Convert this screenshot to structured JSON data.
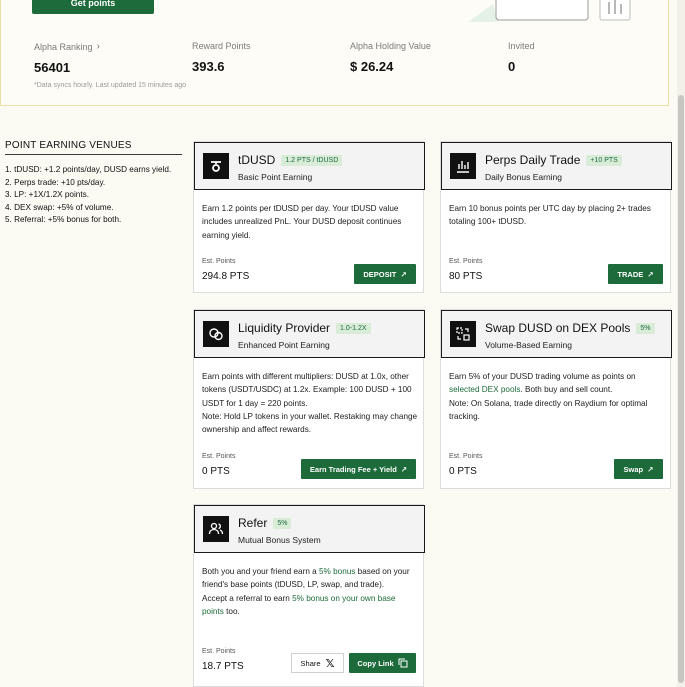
{
  "header": {
    "get_points_label": "Get points",
    "stats": [
      {
        "label": "Alpha Ranking",
        "value": "56401"
      },
      {
        "label": "Reward Points",
        "value": "393.6"
      },
      {
        "label": "Alpha Holding Value",
        "value": "$ 26.24"
      },
      {
        "label": "Invited",
        "value": "0"
      }
    ],
    "sync_note": "*Data syncs hourly. Last updated 15 minutes ago"
  },
  "venues": {
    "title": "POINT EARNING VENUES",
    "items": [
      "1. tDUSD: +1.2 points/day, DUSD earns yield.",
      "2. Perps trade: +10 pts/day.",
      "3. LP: +1X/1.2X points.",
      "4. DEX swap: +5% of volume.",
      "5. Referral: +5% bonus for both."
    ]
  },
  "cards": {
    "tdusd": {
      "title": "tDUSD",
      "badge": "1.2 PTS / tDUSD",
      "subtitle": "Basic Point Earning",
      "body": "Earn 1.2 points per tDUSD per day. Your tDUSD value includes unrealized PnL. Your DUSD deposit continues earning yield.",
      "est_label": "Est. Points",
      "est_value": "294.8 PTS",
      "button": "DEPOSIT"
    },
    "perps": {
      "title": "Perps Daily Trade",
      "badge": "+10 PTS",
      "subtitle": "Daily Bonus Earning",
      "body": "Earn 10 bonus points per UTC day by placing 2+ trades totaling 100+ tDUSD.",
      "est_label": "Est. Points",
      "est_value": "80 PTS",
      "button": "TRADE"
    },
    "lp": {
      "title": "Liquidity Provider",
      "badge": "1.0-1.2X",
      "subtitle": "Enhanced Point Earning",
      "body": "Earn points with different multipliers: DUSD at 1.0x, other tokens (USDT/USDC) at 1.2x. Example: 100 DUSD + 100 USDT for 1 day = 220 points.",
      "note": "Note: Hold LP tokens in your wallet. Restaking may change ownership and affect rewards.",
      "est_label": "Est. Points",
      "est_value": "0 PTS",
      "button": "Earn Trading Fee + Yield"
    },
    "swap": {
      "title": "Swap DUSD on DEX Pools",
      "badge": "5%",
      "subtitle": "Volume-Based Earning",
      "body_pre": "Earn 5% of your DUSD trading volume as points on ",
      "body_link": "selected DEX pools",
      "body_post": ". Both buy and sell count.",
      "note": "Note: On Solana, trade directly on Raydium for optimal tracking.",
      "est_label": "Est. Points",
      "est_value": "0 PTS",
      "button": "Swap"
    },
    "refer": {
      "title": "Refer",
      "badge": "5%",
      "subtitle": "Mutual Bonus System",
      "body_pre": "Both you and your friend earn a ",
      "body_link": "5% bonus",
      "body_post": " based on your friend's base points (tDUSD, LP, swap, and trade).",
      "body2_pre": "Accept a referral to earn ",
      "body2_link": "5% bonus on your own base points",
      "body2_post": " too.",
      "est_label": "Est. Points",
      "est_value": "18.7 PTS",
      "share_button": "Share",
      "copy_button": "Copy Link"
    }
  },
  "colors": {
    "accent": "#1d6b3a",
    "badge_bg": "#d8ecd8",
    "page_bg": "#fbfaf3"
  }
}
